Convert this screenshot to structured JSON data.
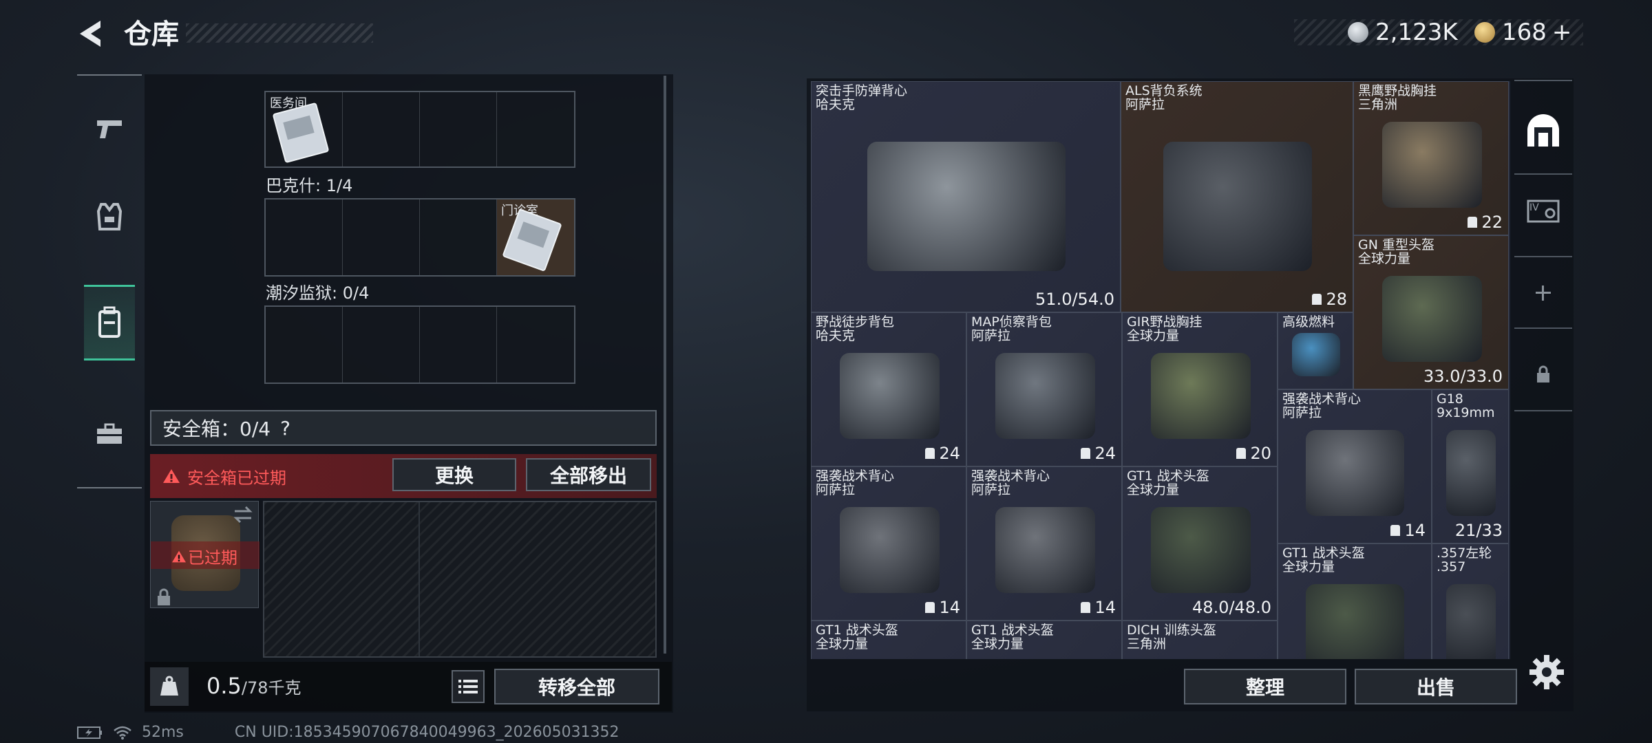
{
  "header": {
    "title": "仓库",
    "currency_1": "2,123K",
    "currency_2": "168",
    "plus": "+"
  },
  "left_panel": {
    "box1_cell_tag": "医务间",
    "box2_label": "巴克什: 1/4",
    "box2_cell_tag": "门诊室",
    "box3_label": "潮汐监狱: 0/4",
    "safe_label": "安全箱：0/4",
    "safe_help": "?",
    "expired_text": "安全箱已过期",
    "replace_btn": "更换",
    "move_all_btn": "全部移出",
    "expired_badge": "已过期",
    "weight_value": "0.5",
    "weight_max": "/78千克",
    "transfer_all_btn": "转移全部"
  },
  "status": {
    "ping": "52ms",
    "uid": "CN UID:185345907067840049963_202605031352"
  },
  "inventory": [
    {
      "name": "突击手防弹背心",
      "sub": "哈夫克",
      "value": "51.0/54.0"
    },
    {
      "name": "ALS背负系统",
      "sub": "阿萨拉",
      "value": "28"
    },
    {
      "name": "黑鹰野战胸挂",
      "sub": "三角洲",
      "value": "22"
    },
    {
      "name": "GN 重型头盔",
      "sub": "全球力量",
      "value": "33.0/33.0"
    },
    {
      "name": "野战徒步背包",
      "sub": "哈夫克",
      "value": "24"
    },
    {
      "name": "MAP侦察背包",
      "sub": "阿萨拉",
      "value": "24"
    },
    {
      "name": "GIR野战胸挂",
      "sub": "全球力量",
      "value": "20"
    },
    {
      "name": "高级燃料",
      "sub": "",
      "value": ""
    },
    {
      "name": "强袭战术背心",
      "sub": "阿萨拉",
      "value": "14"
    },
    {
      "name": "G18",
      "sub": "9x19mm",
      "value": "21/33"
    },
    {
      "name": "强袭战术背心",
      "sub": "阿萨拉",
      "value": "14"
    },
    {
      "name": "强袭战术背心",
      "sub": "阿萨拉",
      "value": "14"
    },
    {
      "name": "GT1 战术头盔",
      "sub": "全球力量",
      "value": "48.0/48.0"
    },
    {
      "name": "GT1 战术头盔",
      "sub": "全球力量",
      "value": ""
    },
    {
      "name": ".357左轮",
      "sub": ".357",
      "value": ""
    },
    {
      "name": "GT1 战术头盔",
      "sub": "全球力量",
      "value": ""
    },
    {
      "name": "GT1 战术头盔",
      "sub": "全球力量",
      "value": ""
    },
    {
      "name": "DICH 训练头盔",
      "sub": "三角洲",
      "value": ""
    }
  ],
  "actions": {
    "sort_btn": "整理",
    "sell_btn": "出售"
  },
  "colors": {
    "accent_green": "#3fc39a",
    "warning_red": "#ff5a5a",
    "gold_item_bg": "#3a2e28"
  },
  "icons": [
    "back-arrow-icon",
    "silver-coin-icon",
    "gold-coin-icon",
    "pistol-icon",
    "vest-icon",
    "backpack-icon",
    "toolbox-icon",
    "warning-icon",
    "swap-icon",
    "lock-icon",
    "kg-icon",
    "list-icon",
    "vault-icon",
    "keycard-icon",
    "plus-icon",
    "gear-icon",
    "battery-icon",
    "wifi-icon"
  ]
}
